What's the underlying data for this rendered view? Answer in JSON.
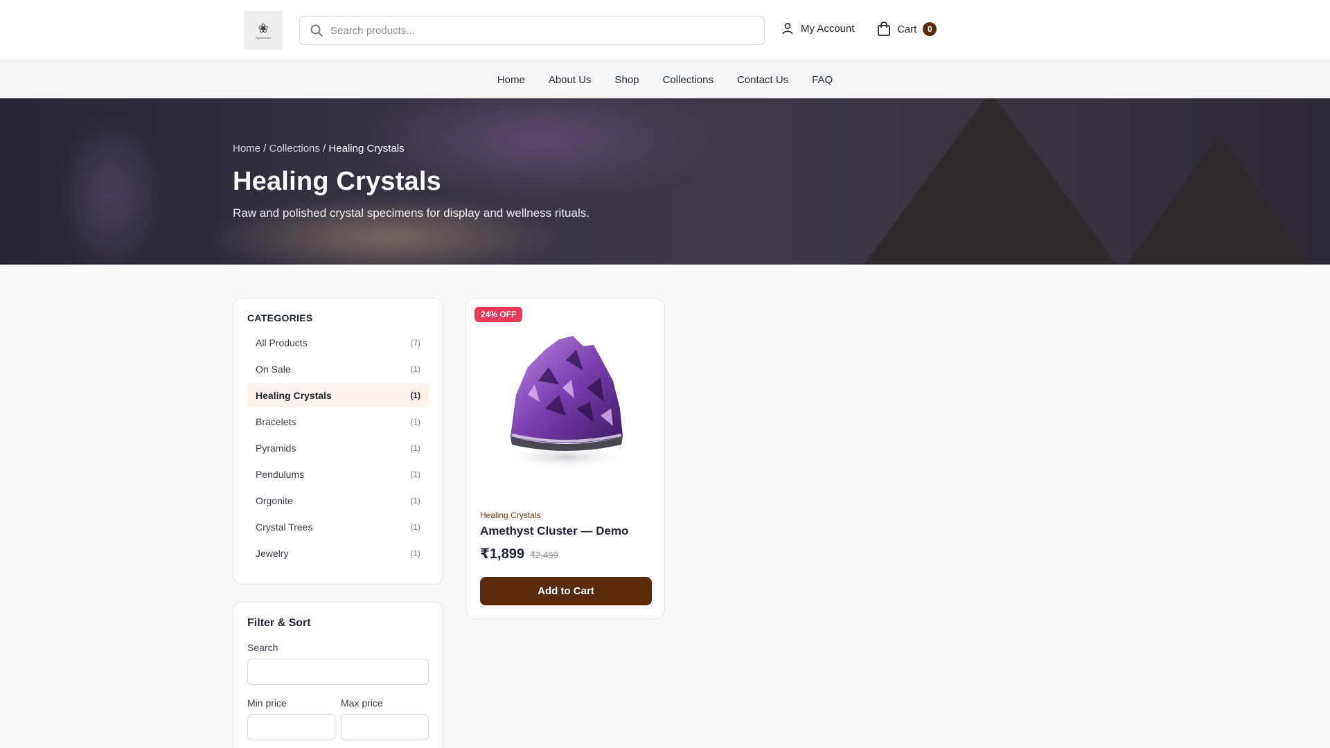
{
  "header": {
    "logo_text": "AgateHeart",
    "search_placeholder": "Search products...",
    "account_label": "My Account",
    "cart_label": "Cart",
    "cart_count": "0"
  },
  "nav": {
    "items": [
      "Home",
      "About Us",
      "Shop",
      "Collections",
      "Contact Us",
      "FAQ"
    ]
  },
  "hero": {
    "breadcrumb": {
      "home": "Home",
      "sep1": " / ",
      "collections": "Collections",
      "sep2": " / ",
      "current": "Healing Crystals"
    },
    "title": "Healing Crystals",
    "subtitle": "Raw and polished crystal specimens for display and wellness rituals."
  },
  "sidebar": {
    "categories_title": "CATEGORIES",
    "categories": [
      {
        "label": "All Products",
        "count": "(7)"
      },
      {
        "label": "On Sale",
        "count": "(1)"
      },
      {
        "label": "Healing Crystals",
        "count": "(1)"
      },
      {
        "label": "Bracelets",
        "count": "(1)"
      },
      {
        "label": "Pyramids",
        "count": "(1)"
      },
      {
        "label": "Pendulums",
        "count": "(1)"
      },
      {
        "label": "Orgonite",
        "count": "(1)"
      },
      {
        "label": "Crystal Trees",
        "count": "(1)"
      },
      {
        "label": "Jewelry",
        "count": "(1)"
      }
    ],
    "active_category": "Healing Crystals",
    "filter": {
      "title": "Filter & Sort",
      "search_label": "Search",
      "min_price_label": "Min price",
      "max_price_label": "Max price"
    }
  },
  "product": {
    "badge": "24% OFF",
    "category": "Healing Crystals",
    "name": "Amethyst Cluster — Demo",
    "price": "₹1,899",
    "old_price": "₹2,499",
    "add_to_cart": "Add to Cart"
  },
  "colors": {
    "brand": "#5a2b0a",
    "badge": "#e83a5b",
    "active_bg": "#fbf3ec"
  }
}
